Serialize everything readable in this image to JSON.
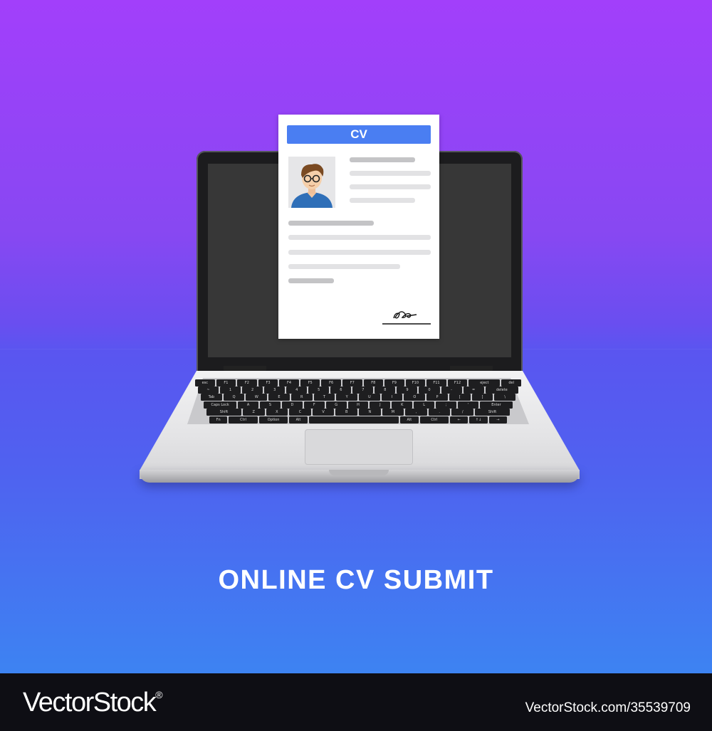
{
  "cv_card": {
    "header_label": "CV"
  },
  "caption": "ONLINE CV SUBMIT",
  "footer": {
    "brand": "VectorStock",
    "brand_mark": "®",
    "image_id": "VectorStock.com/35539709"
  },
  "keyboard": {
    "rows": [
      [
        "esc",
        "F1",
        "F2",
        "F3",
        "F4",
        "F5",
        "F6",
        "F7",
        "F8",
        "F9",
        "F10",
        "F11",
        "F12",
        "eject",
        "del"
      ],
      [
        "~",
        "1",
        "2",
        "3",
        "4",
        "5",
        "6",
        "7",
        "8",
        "9",
        "0",
        "-",
        "=",
        "delete"
      ],
      [
        "Tab",
        "Q",
        "W",
        "E",
        "R",
        "T",
        "Y",
        "U",
        "I",
        "O",
        "P",
        "[",
        "]",
        "\\"
      ],
      [
        "Caps Lock",
        "A",
        "S",
        "D",
        "F",
        "G",
        "H",
        "J",
        "K",
        "L",
        ";",
        "'",
        "Enter"
      ],
      [
        "Shift",
        "Z",
        "X",
        "C",
        "V",
        "B",
        "N",
        "M",
        ",",
        ".",
        "/",
        "Shift"
      ],
      [
        "Fn",
        "Ctrl",
        "Option",
        "Alt",
        "",
        "Alt",
        "Ctrl",
        "←",
        "↑↓",
        "→"
      ]
    ]
  },
  "colors": {
    "background_top": "#a23ffb",
    "background_bottom": "#3d83f2",
    "cv_header": "#4a7ef2",
    "footer": "#0e0e14"
  },
  "icons": [
    "person-avatar-icon",
    "signature-icon"
  ]
}
